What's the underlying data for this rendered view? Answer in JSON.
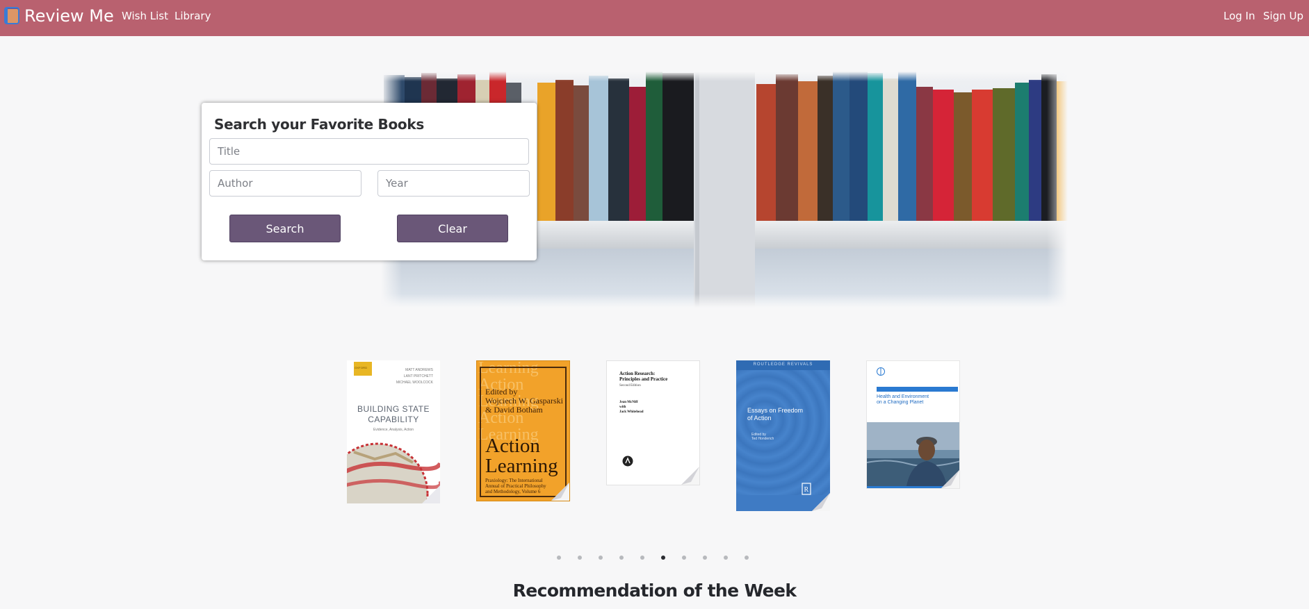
{
  "nav": {
    "brand": "Review Me",
    "links": [
      "Wish List",
      "Library"
    ],
    "auth": [
      "Log In",
      "Sign Up"
    ]
  },
  "search": {
    "title": "Search your Favorite Books",
    "title_placeholder": "Title",
    "author_placeholder": "Author",
    "year_placeholder": "Year",
    "search_label": "Search",
    "clear_label": "Clear"
  },
  "carousel": {
    "books": [
      {
        "publisher": "OXFORD",
        "authors": [
          "MATT ANDREWS",
          "LANT PRITCHETT",
          "MICHAEL WOOLCOCK"
        ],
        "title_lines": [
          "BUILDING STATE",
          "CAPABILITY"
        ],
        "subtitle": "Evidence, Analysis, Action"
      },
      {
        "editor_lines": [
          "Edited by",
          "Wojciech W. Gasparski",
          "& David Botham"
        ],
        "title_lines": [
          "Action",
          "Learning"
        ],
        "series_lines": [
          "Praxiology: The International",
          "Annual of Practical Philosophy",
          "and Methodology, Volume 6"
        ]
      },
      {
        "title_lines": [
          "Action Research:",
          "Principles and Practice"
        ],
        "edition": "Second Edition",
        "author_lines": [
          "Jean McNiff",
          "with",
          "Jack Whitehead"
        ]
      },
      {
        "series": "ROUTLEDGE REVIVALS",
        "title_lines": [
          "Essays on Freedom",
          "of Action"
        ],
        "editor": "Edited by",
        "editor_name": "Ted Honderich"
      },
      {
        "title_lines": [
          "Health and Environment",
          "on a Changing Planet"
        ]
      }
    ],
    "dot_count": 10,
    "active_dot": 5
  },
  "recommendation": {
    "title": "Recommendation of the Week"
  },
  "colors": {
    "navbar": "#b9616f",
    "button": "#6a5778",
    "background": "#f7f7f8"
  }
}
